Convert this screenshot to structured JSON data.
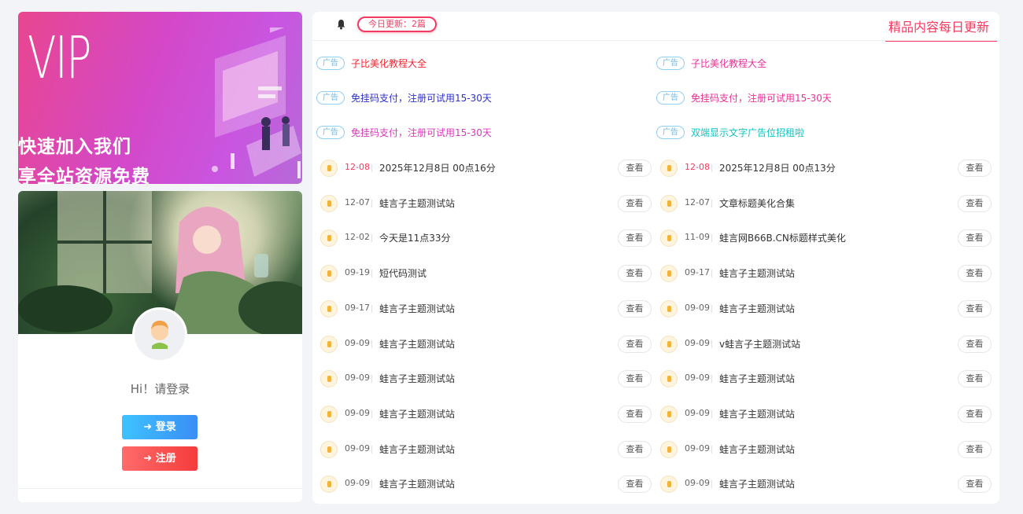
{
  "banner": {
    "big": "VIP",
    "line1": "快速加入我们",
    "line2": "享全站资源免费"
  },
  "profile": {
    "greeting": "Hi！请登录",
    "login": "➜ 登录",
    "register": "➜ 注册"
  },
  "topbar": {
    "today": "今日更新：2篇",
    "daily": "精品内容每日更新"
  },
  "ads": [
    {
      "tag": "广告",
      "text": "子比美化教程大全",
      "color": "#f5222d"
    },
    {
      "tag": "广告",
      "text": "子比美化教程大全",
      "color": "#eb2f96"
    },
    {
      "tag": "广告",
      "text": "免挂码支付，注册可试用15-30天",
      "color": "#2f30c9"
    },
    {
      "tag": "广告",
      "text": "免挂码支付，注册可试用15-30天",
      "color": "#eb2f96"
    },
    {
      "tag": "广告",
      "text": "免挂码支付，注册可试用15-30天",
      "color": "#d63aba"
    },
    {
      "tag": "广告",
      "text": "双端显示文字广告位招租啦",
      "color": "#13c2c2"
    }
  ],
  "view_label": "查看",
  "posts": [
    {
      "date": "12-08",
      "title": "2025年12月8日 00点16分",
      "hl": true
    },
    {
      "date": "12-08",
      "title": "2025年12月8日 00点13分",
      "hl": true
    },
    {
      "date": "12-07",
      "title": "蛙言子主题测试站"
    },
    {
      "date": "12-07",
      "title": "文章标题美化合集"
    },
    {
      "date": "12-02",
      "title": "今天是11点33分"
    },
    {
      "date": "11-09",
      "title": "蛙言网B66B.CN标题样式美化"
    },
    {
      "date": "09-19",
      "title": "短代码测试"
    },
    {
      "date": "09-17",
      "title": "蛙言子主题测试站"
    },
    {
      "date": "09-17",
      "title": "蛙言子主题测试站"
    },
    {
      "date": "09-09",
      "title": "蛙言子主题测试站"
    },
    {
      "date": "09-09",
      "title": "蛙言子主题测试站"
    },
    {
      "date": "09-09",
      "title": "v蛙言子主题测试站"
    },
    {
      "date": "09-09",
      "title": "蛙言子主题测试站"
    },
    {
      "date": "09-09",
      "title": "蛙言子主题测试站"
    },
    {
      "date": "09-09",
      "title": "蛙言子主题测试站"
    },
    {
      "date": "09-09",
      "title": "蛙言子主题测试站"
    },
    {
      "date": "09-09",
      "title": "蛙言子主题测试站"
    },
    {
      "date": "09-09",
      "title": "蛙言子主题测试站"
    },
    {
      "date": "09-09",
      "title": "蛙言子主题测试站"
    },
    {
      "date": "09-09",
      "title": "蛙言子主题测试站"
    }
  ]
}
